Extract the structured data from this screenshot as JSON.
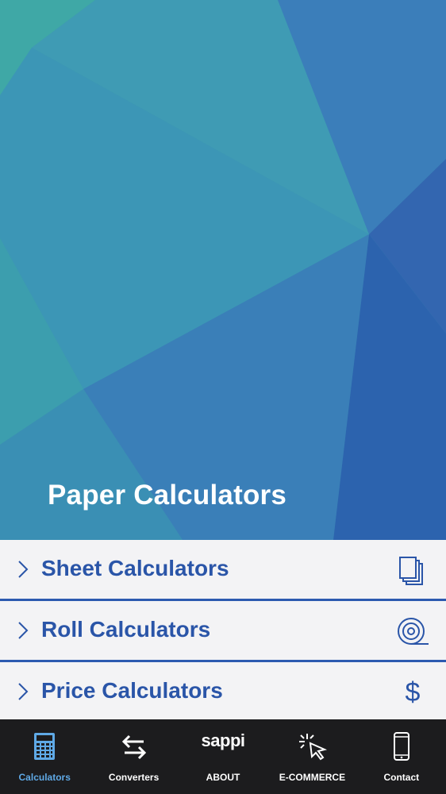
{
  "hero": {
    "title": "Paper Calculators"
  },
  "menu": {
    "items": [
      {
        "label": "Sheet Calculators",
        "icon": "sheets-icon"
      },
      {
        "label": "Roll Calculators",
        "icon": "roll-icon"
      },
      {
        "label": "Price Calculators",
        "icon": "dollar-icon",
        "symbol": "$"
      }
    ]
  },
  "tabbar": {
    "tabs": [
      {
        "label": "Calculators",
        "icon": "calculator-icon",
        "active": true
      },
      {
        "label": "Converters",
        "icon": "swap-arrows-icon",
        "active": false
      },
      {
        "label": "ABOUT",
        "logo": "sappi",
        "active": false
      },
      {
        "label": "E-COMMERCE",
        "icon": "cursor-click-icon",
        "active": false
      },
      {
        "label": "Contact",
        "icon": "phone-icon",
        "active": false
      }
    ]
  },
  "colors": {
    "accent": "#2a55a8",
    "active_tab": "#5fa9e6",
    "tabbar_bg": "#1c1c1e",
    "menu_bg": "#f3f3f5"
  }
}
